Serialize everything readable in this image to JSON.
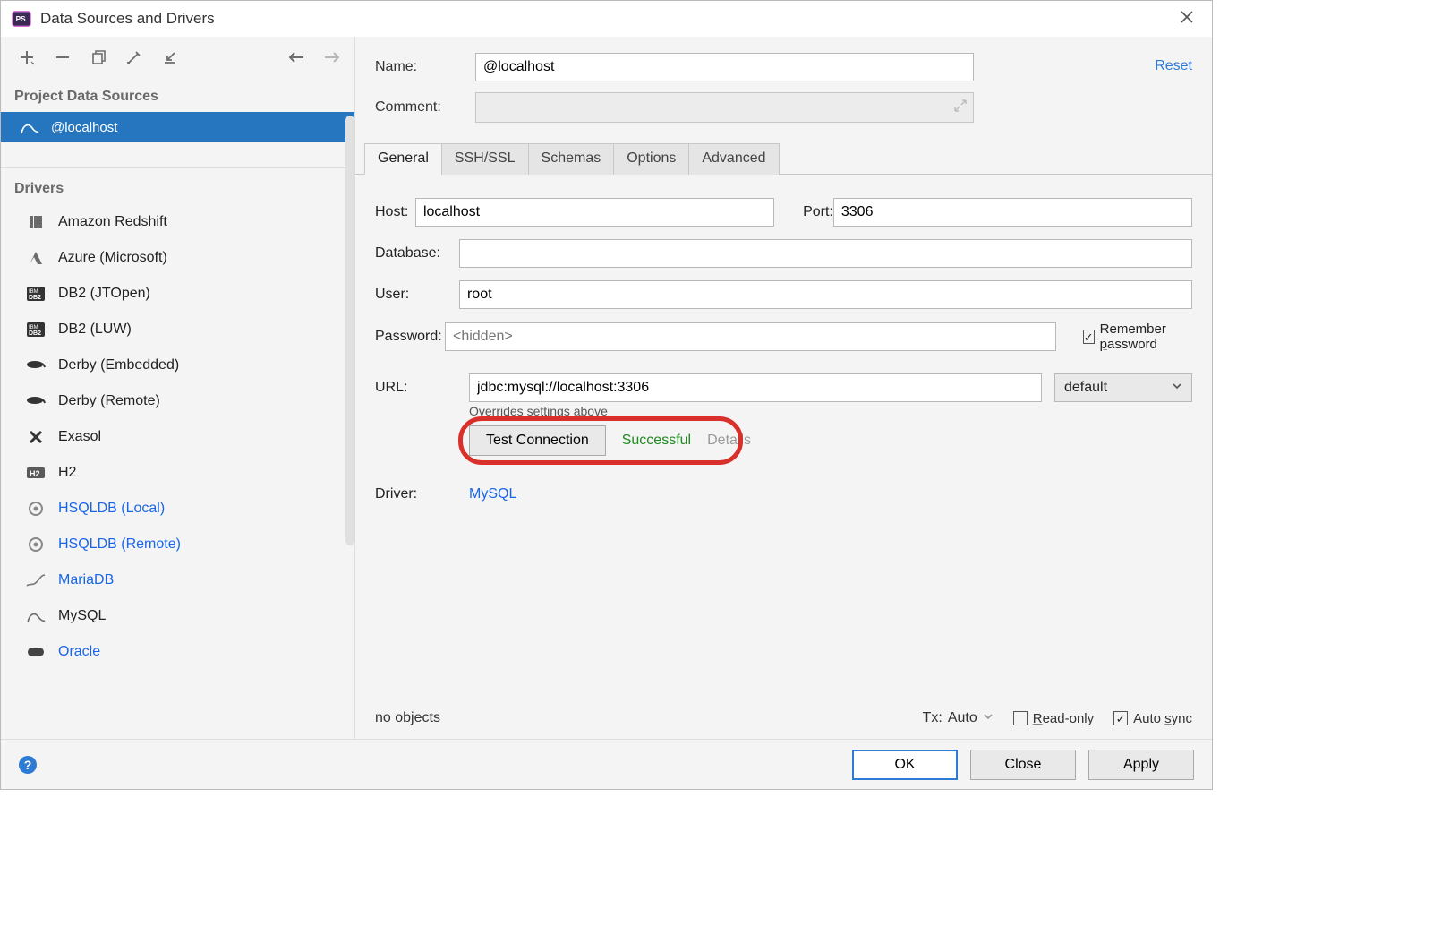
{
  "window": {
    "title": "Data Sources and Drivers"
  },
  "toolbar": {
    "back_enabled": true,
    "forward_enabled": false
  },
  "sidebar": {
    "sections": {
      "data_sources_title": "Project Data Sources",
      "drivers_title": "Drivers"
    },
    "data_sources": [
      {
        "name": "@localhost",
        "icon": "mysql",
        "selected": true
      }
    ],
    "drivers": [
      {
        "name": "Amazon Redshift",
        "icon": "redshift",
        "link": false
      },
      {
        "name": "Azure (Microsoft)",
        "icon": "azure",
        "link": false
      },
      {
        "name": "DB2 (JTOpen)",
        "icon": "db2",
        "link": false
      },
      {
        "name": "DB2 (LUW)",
        "icon": "db2",
        "link": false
      },
      {
        "name": "Derby (Embedded)",
        "icon": "derby",
        "link": false
      },
      {
        "name": "Derby (Remote)",
        "icon": "derby",
        "link": false
      },
      {
        "name": "Exasol",
        "icon": "exasol",
        "link": false
      },
      {
        "name": "H2",
        "icon": "h2",
        "link": false
      },
      {
        "name": "HSQLDB (Local)",
        "icon": "hsqldb",
        "link": true
      },
      {
        "name": "HSQLDB (Remote)",
        "icon": "hsqldb",
        "link": true
      },
      {
        "name": "MariaDB",
        "icon": "mariadb",
        "link": true
      },
      {
        "name": "MySQL",
        "icon": "mysql",
        "link": false
      },
      {
        "name": "Oracle",
        "icon": "oracle",
        "link": true
      }
    ]
  },
  "form": {
    "name_label": "Name:",
    "name_value": "@localhost",
    "comment_label": "Comment:",
    "reset_label": "Reset",
    "tabs": [
      "General",
      "SSH/SSL",
      "Schemas",
      "Options",
      "Advanced"
    ],
    "active_tab": 0,
    "general": {
      "host_label": "Host:",
      "host_value": "localhost",
      "port_label": "Port:",
      "port_value": "3306",
      "database_label": "Database:",
      "database_value": "",
      "user_label": "User:",
      "user_value": "root",
      "password_label": "Password:",
      "password_placeholder": "<hidden>",
      "remember_password_label": "Remember password",
      "remember_password_checked": true,
      "url_label": "URL:",
      "url_value": "jdbc:mysql://localhost:3306",
      "url_mode": "default",
      "url_hint": "Overrides settings above",
      "test_connection_label": "Test Connection",
      "test_status": "Successful",
      "details_label": "Details",
      "driver_label": "Driver:",
      "driver_value": "MySQL"
    },
    "status": {
      "objects": "no objects",
      "tx_label": "Tx:",
      "tx_value": "Auto",
      "read_only_label": "Read-only",
      "read_only_checked": false,
      "auto_sync_label": "Auto sync",
      "auto_sync_checked": true
    }
  },
  "footer": {
    "ok": "OK",
    "close": "Close",
    "apply": "Apply"
  },
  "colors": {
    "selection": "#2675bf",
    "link": "#1a66e8",
    "success": "#1f8a1f",
    "callout": "#d9302c"
  }
}
